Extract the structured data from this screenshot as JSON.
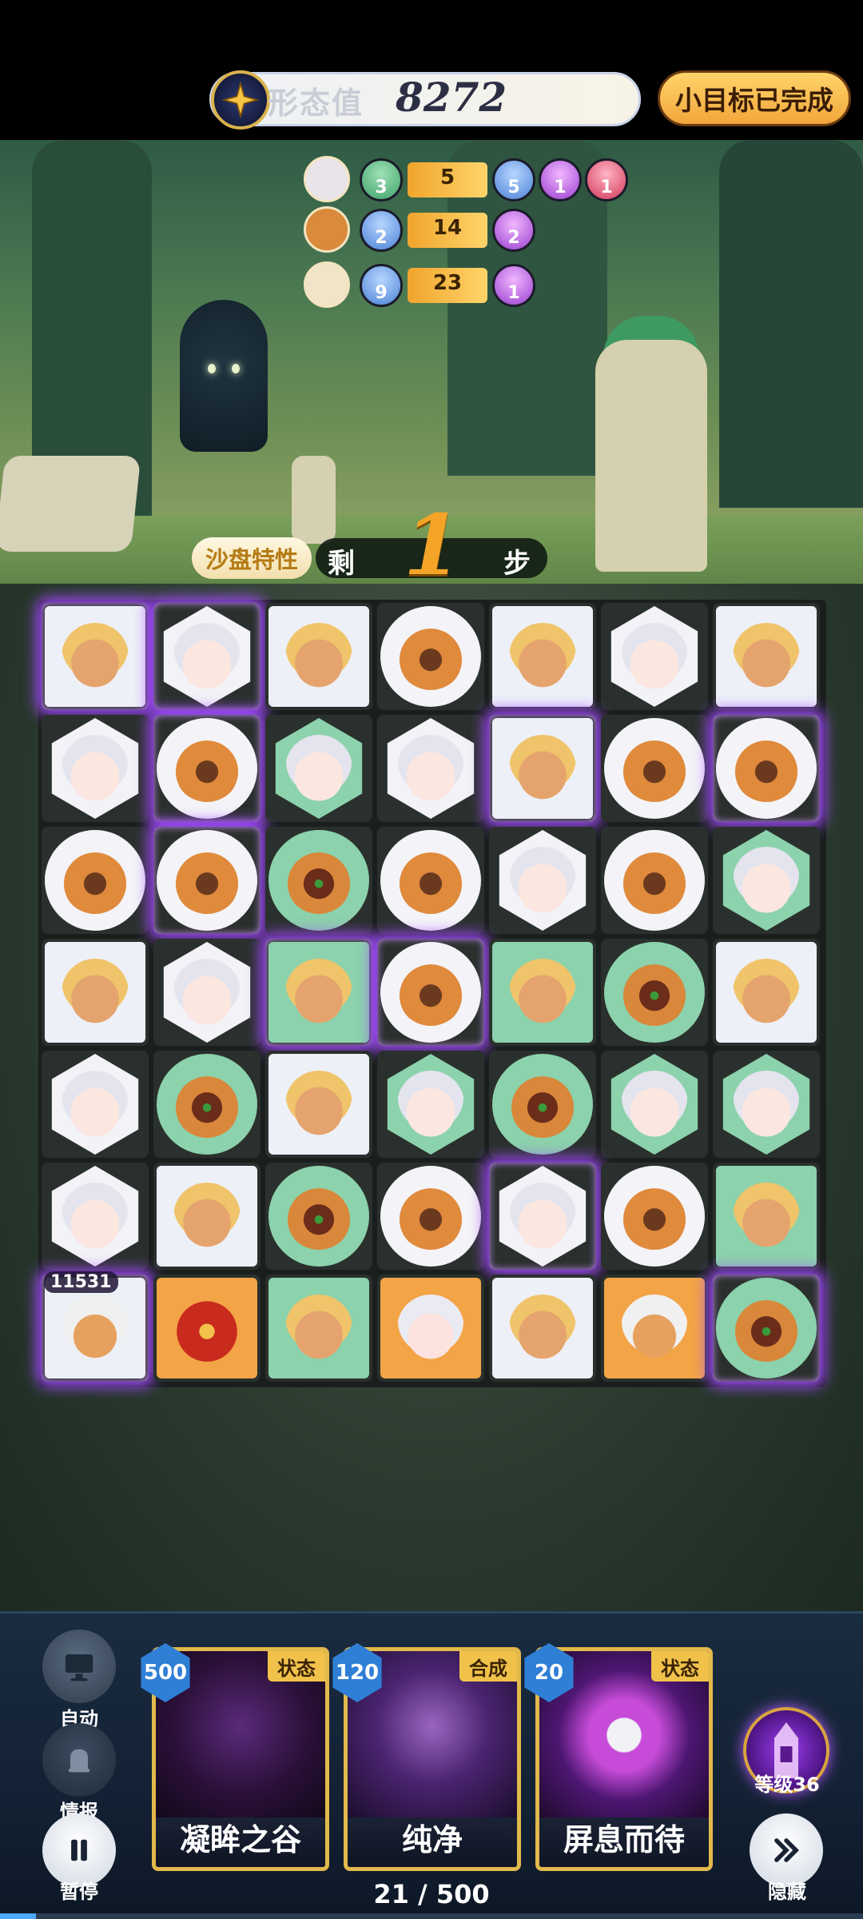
{
  "header": {
    "score_label": "形态值",
    "score_value": "8272",
    "goal_button_label": "小目标已完成"
  },
  "objectives": [
    {
      "avatar_icon": "goat-girl-avatar",
      "orbs_left": [
        {
          "color": "green",
          "value": "3"
        }
      ],
      "bar_value": "5",
      "orbs_right": [
        {
          "color": "blue",
          "value": "5"
        },
        {
          "color": "purple",
          "value": "1"
        },
        {
          "color": "red",
          "value": "1"
        }
      ]
    },
    {
      "avatar_icon": "beast-avatar",
      "orbs_left": [
        {
          "color": "blue",
          "value": "2"
        }
      ],
      "bar_value": "14",
      "orbs_right": [
        {
          "color": "purple",
          "value": "2"
        }
      ]
    },
    {
      "avatar_icon": "blonde-avatar",
      "orbs_left": [
        {
          "color": "blue",
          "value": "9"
        }
      ],
      "bar_value": "23",
      "orbs_right": [
        {
          "color": "purple",
          "value": "1"
        }
      ]
    }
  ],
  "steps": {
    "sandbox_label": "沙盘特性",
    "remaining_label": "剩",
    "remaining_value": "1",
    "unit_label": "步"
  },
  "board": {
    "rows": [
      [
        [
          "blonde",
          "square",
          "white",
          true
        ],
        [
          "white",
          "hex",
          "white",
          true
        ],
        [
          "blonde",
          "square",
          "white",
          false
        ],
        [
          "monk",
          "circle",
          "white",
          false
        ],
        [
          "blonde",
          "square",
          "white",
          false
        ],
        [
          "white",
          "hex",
          "white",
          false
        ],
        [
          "blonde",
          "square",
          "white",
          false
        ]
      ],
      [
        [
          "white",
          "hex",
          "white",
          false
        ],
        [
          "monk",
          "circle",
          "white",
          true
        ],
        [
          "white",
          "hex",
          "green",
          false
        ],
        [
          "white",
          "hex",
          "white",
          false
        ],
        [
          "blonde",
          "square",
          "white",
          true
        ],
        [
          "monk",
          "circle",
          "white",
          false
        ],
        [
          "monk",
          "circle",
          "white",
          true
        ]
      ],
      [
        [
          "monk",
          "circle",
          "white",
          false
        ],
        [
          "monk",
          "circle",
          "white",
          true
        ],
        [
          "beast",
          "circle",
          "green",
          false
        ],
        [
          "monk",
          "circle",
          "white",
          false
        ],
        [
          "white",
          "hex",
          "white",
          false
        ],
        [
          "monk",
          "circle",
          "white",
          false
        ],
        [
          "white",
          "hex",
          "green",
          false
        ]
      ],
      [
        [
          "blonde",
          "square",
          "white",
          false
        ],
        [
          "white",
          "hex",
          "white",
          false
        ],
        [
          "blonde",
          "square",
          "green",
          true
        ],
        [
          "monk",
          "circle",
          "white",
          true
        ],
        [
          "blonde",
          "square",
          "green",
          false
        ],
        [
          "beast",
          "circle",
          "green",
          false
        ],
        [
          "blonde",
          "square",
          "white",
          false
        ]
      ],
      [
        [
          "white",
          "hex",
          "white",
          false
        ],
        [
          "beast",
          "circle",
          "green",
          false
        ],
        [
          "blonde",
          "square",
          "white",
          false
        ],
        [
          "white",
          "hex",
          "green",
          false
        ],
        [
          "beast",
          "circle",
          "green",
          false
        ],
        [
          "white",
          "hex",
          "green",
          false
        ],
        [
          "white",
          "hex",
          "green",
          false
        ]
      ],
      [
        [
          "white",
          "hex",
          "white",
          false
        ],
        [
          "blonde",
          "square",
          "white",
          false
        ],
        [
          "beast",
          "circle",
          "green",
          false
        ],
        [
          "monk",
          "circle",
          "white",
          false
        ],
        [
          "white",
          "hex",
          "white",
          true
        ],
        [
          "monk",
          "circle",
          "white",
          false
        ],
        [
          "blonde",
          "square",
          "green",
          false
        ]
      ],
      [
        [
          "wolf",
          "square",
          "white",
          true
        ],
        [
          "boss-red",
          "square",
          "gold",
          false
        ],
        [
          "blonde",
          "square",
          "green",
          false
        ],
        [
          "goatgirl",
          "square",
          "gold",
          false
        ],
        [
          "blonde",
          "square",
          "white",
          false
        ],
        [
          "wolf",
          "square",
          "gold",
          false
        ],
        [
          "beast",
          "circle",
          "green",
          true
        ]
      ]
    ],
    "boss_hp": "11531"
  },
  "controls": {
    "auto_label": "自动",
    "intel_label": "情报",
    "pause_label": "暂停",
    "hide_label": "隐藏",
    "level_label": "等级36"
  },
  "cards": [
    {
      "cost": "500",
      "tag": "状态",
      "name": "凝眸之谷",
      "art": "dark-spiral"
    },
    {
      "cost": "120",
      "tag": "合成",
      "name": "纯净",
      "art": "purple-vortex"
    },
    {
      "cost": "20",
      "tag": "状态",
      "name": "屏息而待",
      "art": "gourd-chains"
    }
  ],
  "progress": {
    "text": "21 / 500",
    "fraction": 0.042
  },
  "colors": {
    "accent_gold": "#f4a427",
    "glow_purple": "#a34bff",
    "tile_green": "#8cd2ac",
    "tile_gold": "#f3a446"
  }
}
